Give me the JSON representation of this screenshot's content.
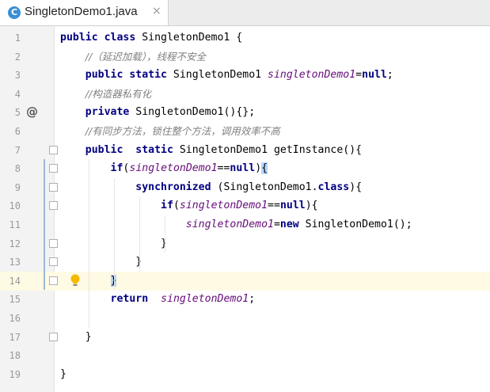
{
  "tab": {
    "icon_letter": "C",
    "title": "SingletonDemo1.java",
    "close_glyph": "×"
  },
  "editor": {
    "current_line": 14,
    "lines": [
      {
        "n": "1",
        "tokens": [
          [
            "kw",
            "public class "
          ],
          [
            "plain",
            "SingletonDemo1 {"
          ]
        ]
      },
      {
        "n": "2",
        "tokens": [
          [
            "plain",
            "    "
          ],
          [
            "cmt",
            "//（延迟加载），线程不安全"
          ]
        ]
      },
      {
        "n": "3",
        "tokens": [
          [
            "plain",
            "    "
          ],
          [
            "kw",
            "public static "
          ],
          [
            "plain",
            "SingletonDemo1 "
          ],
          [
            "field",
            "singletonDemo1"
          ],
          [
            "plain",
            "="
          ],
          [
            "kw",
            "null"
          ],
          [
            "plain",
            ";"
          ]
        ]
      },
      {
        "n": "4",
        "tokens": [
          [
            "plain",
            "    "
          ],
          [
            "cmt",
            "//构造器私有化"
          ]
        ]
      },
      {
        "n": "5",
        "tokens": [
          [
            "plain",
            "    "
          ],
          [
            "kw",
            "private "
          ],
          [
            "plain",
            "SingletonDemo1(){};"
          ]
        ]
      },
      {
        "n": "6",
        "tokens": [
          [
            "plain",
            "    "
          ],
          [
            "cmt",
            "//有同步方法，锁住整个方法，调用效率不高"
          ]
        ]
      },
      {
        "n": "7",
        "tokens": [
          [
            "plain",
            "    "
          ],
          [
            "kw",
            "public  static "
          ],
          [
            "plain",
            "SingletonDemo1 getInstance(){"
          ]
        ]
      },
      {
        "n": "8",
        "tokens": [
          [
            "plain",
            "        "
          ],
          [
            "kw",
            "if"
          ],
          [
            "plain",
            "("
          ],
          [
            "field",
            "singletonDemo1"
          ],
          [
            "plain",
            "=="
          ],
          [
            "kw",
            "null"
          ],
          [
            "plain",
            ")"
          ],
          [
            "hl",
            "{"
          ]
        ]
      },
      {
        "n": "9",
        "tokens": [
          [
            "plain",
            "            "
          ],
          [
            "kw",
            "synchronized "
          ],
          [
            "plain",
            "(SingletonDemo1."
          ],
          [
            "kw",
            "class"
          ],
          [
            "plain",
            "){"
          ]
        ]
      },
      {
        "n": "10",
        "tokens": [
          [
            "plain",
            "                "
          ],
          [
            "kw",
            "if"
          ],
          [
            "plain",
            "("
          ],
          [
            "field",
            "singletonDemo1"
          ],
          [
            "plain",
            "=="
          ],
          [
            "kw",
            "null"
          ],
          [
            "plain",
            "){"
          ]
        ]
      },
      {
        "n": "11",
        "tokens": [
          [
            "plain",
            "                    "
          ],
          [
            "field",
            "singletonDemo1"
          ],
          [
            "plain",
            "="
          ],
          [
            "kw",
            "new "
          ],
          [
            "plain",
            "SingletonDemo1();"
          ]
        ]
      },
      {
        "n": "12",
        "tokens": [
          [
            "plain",
            "                }"
          ]
        ]
      },
      {
        "n": "13",
        "tokens": [
          [
            "plain",
            "            }"
          ]
        ]
      },
      {
        "n": "14",
        "tokens": [
          [
            "plain",
            "        "
          ],
          [
            "hl",
            "}"
          ]
        ]
      },
      {
        "n": "15",
        "tokens": [
          [
            "plain",
            "        "
          ],
          [
            "kw",
            "return  "
          ],
          [
            "field",
            "singletonDemo1"
          ],
          [
            "plain",
            ";"
          ]
        ]
      },
      {
        "n": "16",
        "tokens": []
      },
      {
        "n": "17",
        "tokens": [
          [
            "plain",
            "    }"
          ]
        ]
      },
      {
        "n": "18",
        "tokens": []
      },
      {
        "n": "19",
        "tokens": [
          [
            "plain",
            "}"
          ]
        ]
      }
    ],
    "gutter_icons": {
      "override_marker": "@",
      "intention_bulb_line": 14
    }
  },
  "colors": {
    "keyword": "#000080",
    "field": "#660e7a",
    "comment": "#808080",
    "current_line_bg": "#fffae3",
    "brace_highlight": "#b4d7ff"
  }
}
